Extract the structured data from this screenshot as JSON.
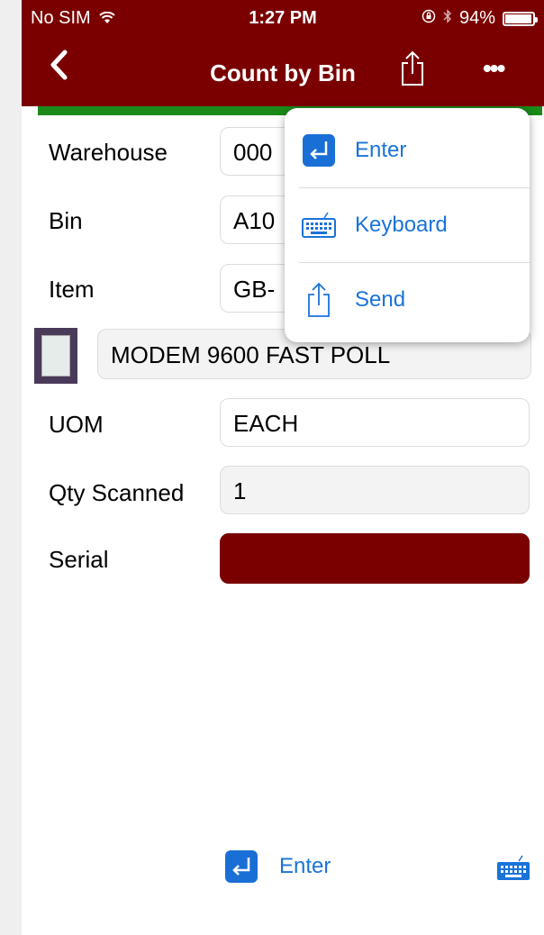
{
  "status": {
    "carrier": "No SIM",
    "time": "1:27 PM",
    "battery": "94%",
    "battery_level": 0.94
  },
  "nav": {
    "back_glyph": "<",
    "title": "Count by Bin",
    "share_icon": "share-icon",
    "more_glyph": "•••"
  },
  "form": {
    "warehouse_label": "Warehouse",
    "warehouse_value": "000",
    "bin_label": "Bin",
    "bin_value": "A10",
    "item_label": "Item",
    "item_value": "GB-",
    "description": "MODEM 9600 FAST POLL",
    "uom_label": "UOM",
    "uom_value": "EACH",
    "qty_label": "Qty Scanned",
    "qty_value": "1",
    "serial_label": "Serial",
    "serial_value": ""
  },
  "menu": {
    "items": [
      {
        "label": "Enter",
        "icon": "enter-icon"
      },
      {
        "label": "Keyboard",
        "icon": "keyboard-icon"
      },
      {
        "label": "Send",
        "icon": "share-icon"
      }
    ]
  },
  "toolbar": {
    "enter_label": "Enter"
  },
  "colors": {
    "brand": "#7a0000",
    "accent": "#1a73d9",
    "success_bar": "#1a8a1a"
  }
}
